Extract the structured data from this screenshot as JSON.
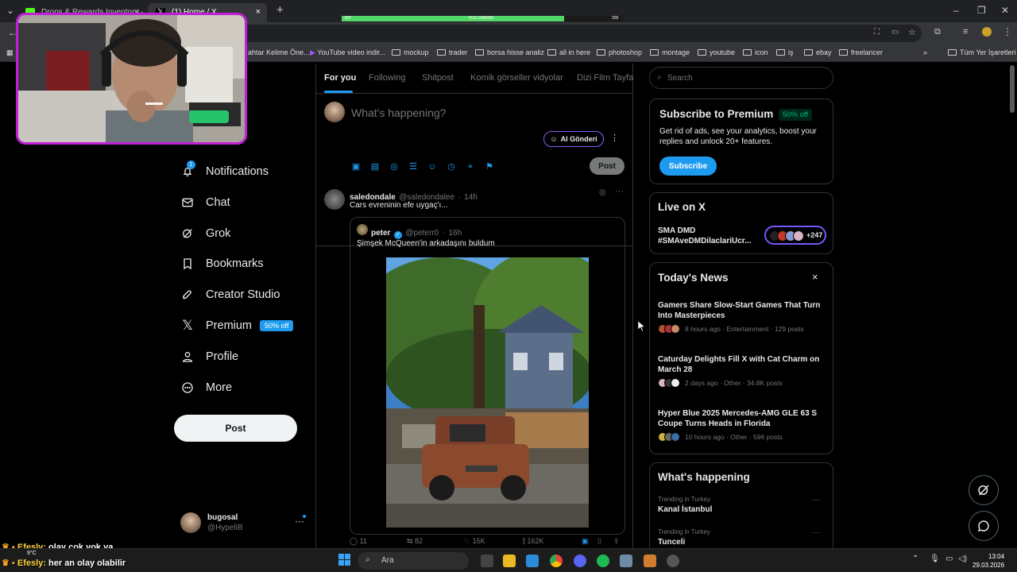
{
  "browser": {
    "tabs": [
      {
        "title": "Drops & Rewards Inventory - K"
      },
      {
        "title": "(1) Home / X"
      }
    ],
    "bookmarks": [
      "ahtar Kelime Öne...",
      "YouTube video indir...",
      "mockup",
      "trader",
      "borsa hisse analiz",
      "all in here",
      "photoshop",
      "montage",
      "youtube",
      "icon",
      "iş",
      "ebay",
      "freelancer"
    ],
    "all_bookmarks_label": "Tüm Yer İşaretleri",
    "stream_bar": {
      "left": "837",
      "center": "FOLLOWERS",
      "right": "200",
      "progress": 0.79
    }
  },
  "nav": {
    "items": [
      {
        "label": "Notifications",
        "icon": "bell-icon"
      },
      {
        "label": "Chat",
        "icon": "envelope-icon"
      },
      {
        "label": "Grok",
        "icon": "grok-icon"
      },
      {
        "label": "Bookmarks",
        "icon": "bookmark-icon"
      },
      {
        "label": "Creator Studio",
        "icon": "rocket-icon"
      },
      {
        "label": "Premium",
        "icon": "x-logo-icon"
      },
      {
        "label": "Profile",
        "icon": "person-icon"
      },
      {
        "label": "More",
        "icon": "more-circle-icon"
      }
    ],
    "notifications_badge": "1",
    "premium_badge": "50% off",
    "post_label": "Post",
    "account": {
      "name": "bugosal",
      "handle": "@HypeliB"
    }
  },
  "feed": {
    "tabs": [
      "For you",
      "Following",
      "Shitpost",
      "Komik görseller vidyolar",
      "Dizi Film Tayfa"
    ],
    "composer": {
      "placeholder": "What's happening?",
      "ai_button": "AI Gönderi",
      "post_label": "Post"
    },
    "tweet": {
      "name": "saledondale",
      "handle": "@saledondalee",
      "time": "14h",
      "text": "Cars evreninin efe uygaç'ı...",
      "quote": {
        "name": "peter",
        "handle": "@peterr0",
        "time": "16h",
        "text": "Şimşek McQueen'in arkadaşını buldum"
      },
      "actions": {
        "replies": "11",
        "reposts": "82",
        "likes": "15K",
        "views": "162K"
      }
    }
  },
  "sidebar": {
    "search_placeholder": "Search",
    "premium": {
      "title": "Subscribe to Premium",
      "badge": "50% off",
      "text": "Get rid of ads, see your analytics, boost your replies and unlock 20+ features.",
      "button": "Subscribe"
    },
    "live": {
      "title": "Live on X",
      "host": "SMA DMD",
      "topic": "#SMAveDMDilaclariUcr...",
      "count": "+247"
    },
    "news": {
      "title": "Today's News",
      "items": [
        {
          "headline": "Gamers Share Slow-Start Games That Turn Into Masterpieces",
          "meta": "8 hours ago · Entertainment · 129 posts"
        },
        {
          "headline": "Caturday Delights Fill X with Cat Charm on March 28",
          "meta": "2 days ago · Other · 34.8K posts"
        },
        {
          "headline": "Hyper Blue 2025 Mercedes-AMG GLE 63 S Coupe Turns Heads in Florida",
          "meta": "10 hours ago · Other · 596 posts"
        }
      ]
    },
    "happening": {
      "title": "What's happening",
      "trends": [
        {
          "label": "Trending in Turkey",
          "name": "Kanal İstanbul"
        },
        {
          "label": "Trending in Turkey",
          "name": "Tunceli"
        }
      ]
    }
  },
  "chat_overlay": [
    {
      "user": "Efesly:",
      "message": "olay çok yok ya"
    },
    {
      "user": "Efesly:",
      "message": "her an olay olabilir"
    }
  ],
  "taskbar": {
    "search_label": "Ara",
    "weather": "9°C",
    "time": "13:04",
    "date": "29.03.2026"
  }
}
